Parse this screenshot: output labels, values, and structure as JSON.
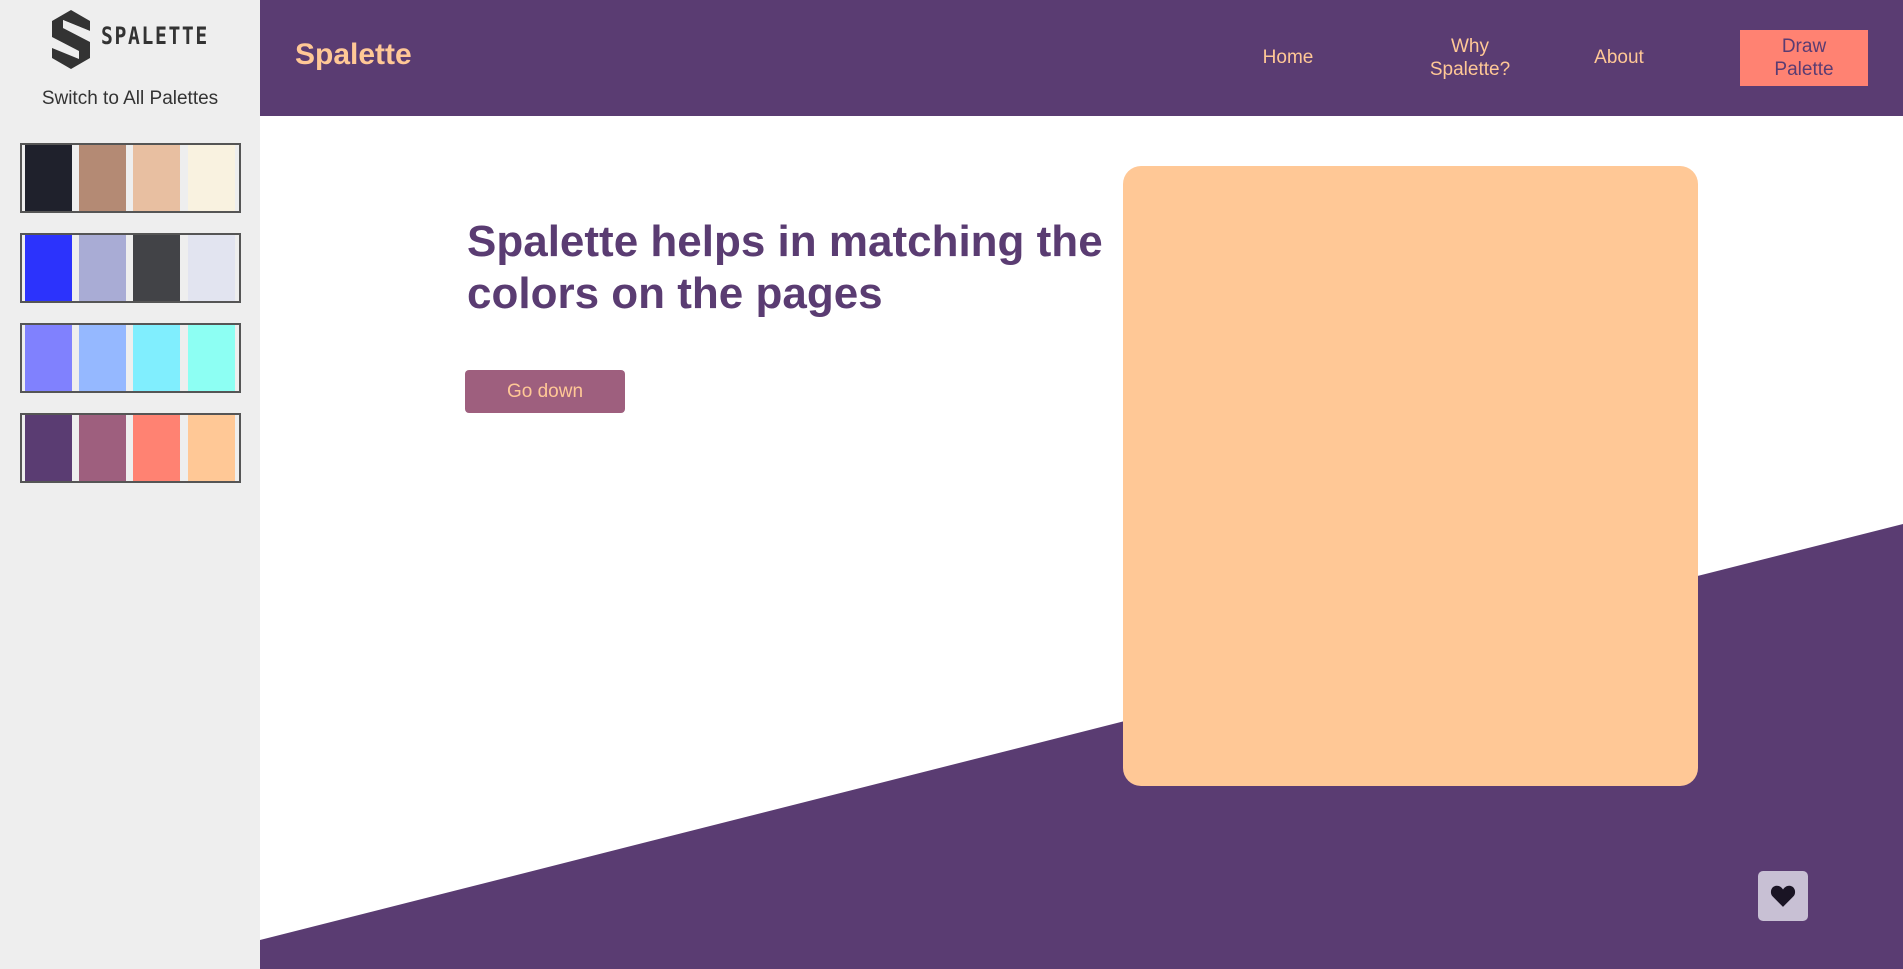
{
  "sidebar": {
    "logo_word": "SPALETTE",
    "switch_label": "Switch to All Palettes",
    "palettes": [
      {
        "colors": [
          "#1f212c",
          "#b48a74",
          "#e8bfa1",
          "#f9f2e0"
        ]
      },
      {
        "colors": [
          "#2c33fc",
          "#a9acd5",
          "#424347",
          "#e2e4f0"
        ]
      },
      {
        "colors": [
          "#8081fe",
          "#95b8ff",
          "#80eefe",
          "#8dfff3"
        ]
      },
      {
        "colors": [
          "#5a3c72",
          "#9e5f7e",
          "#ff8272",
          "#ffc896"
        ]
      }
    ]
  },
  "header": {
    "brand": "Spalette",
    "nav": [
      {
        "label": "Home"
      },
      {
        "label_line1": "Why",
        "label_line2": "Spalette?"
      },
      {
        "label": "About"
      }
    ],
    "draw_button": {
      "line1": "Draw",
      "line2": "Palette"
    }
  },
  "hero": {
    "title": "Spalette helps in matching the colors on the pages",
    "button_label": "Go down"
  },
  "theme": {
    "primary": "#5a3c72",
    "secondary": "#9e5f7e",
    "accent": "#ff8272",
    "light": "#ffc896"
  },
  "favorite_icon": "heart-icon"
}
